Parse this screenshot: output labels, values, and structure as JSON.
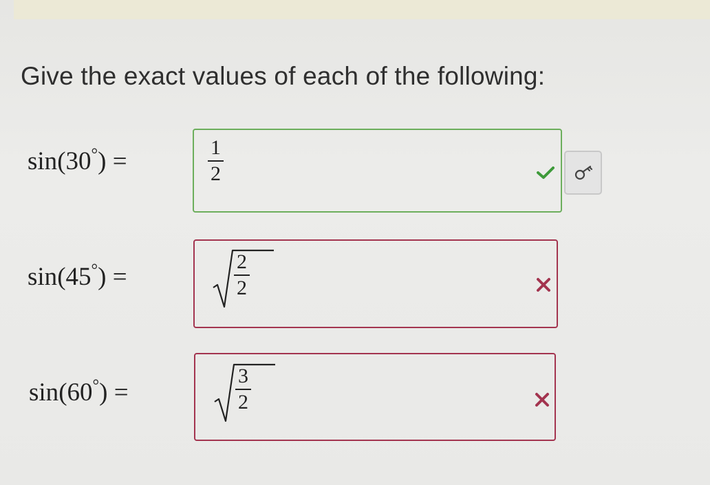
{
  "prompt": "Give the exact values of each of the following:",
  "questions": [
    {
      "fn": "sin",
      "angle": "30",
      "answer_type": "fraction",
      "numerator": "1",
      "denominator": "2",
      "status": "correct",
      "status_icon": "check-icon",
      "status_color": "#3e9a3a",
      "border_color": "#6cae5c"
    },
    {
      "fn": "sin",
      "angle": "45",
      "answer_type": "sqrt-fraction",
      "numerator": "2",
      "denominator": "2",
      "status": "incorrect",
      "status_icon": "x-icon",
      "status_color": "#a3344f",
      "border_color": "#a3344f"
    },
    {
      "fn": "sin",
      "angle": "60",
      "answer_type": "sqrt-fraction",
      "numerator": "3",
      "denominator": "2",
      "status": "incorrect",
      "status_icon": "x-icon",
      "status_color": "#a3344f",
      "border_color": "#a3344f"
    }
  ],
  "key_button_icon": "key-icon"
}
